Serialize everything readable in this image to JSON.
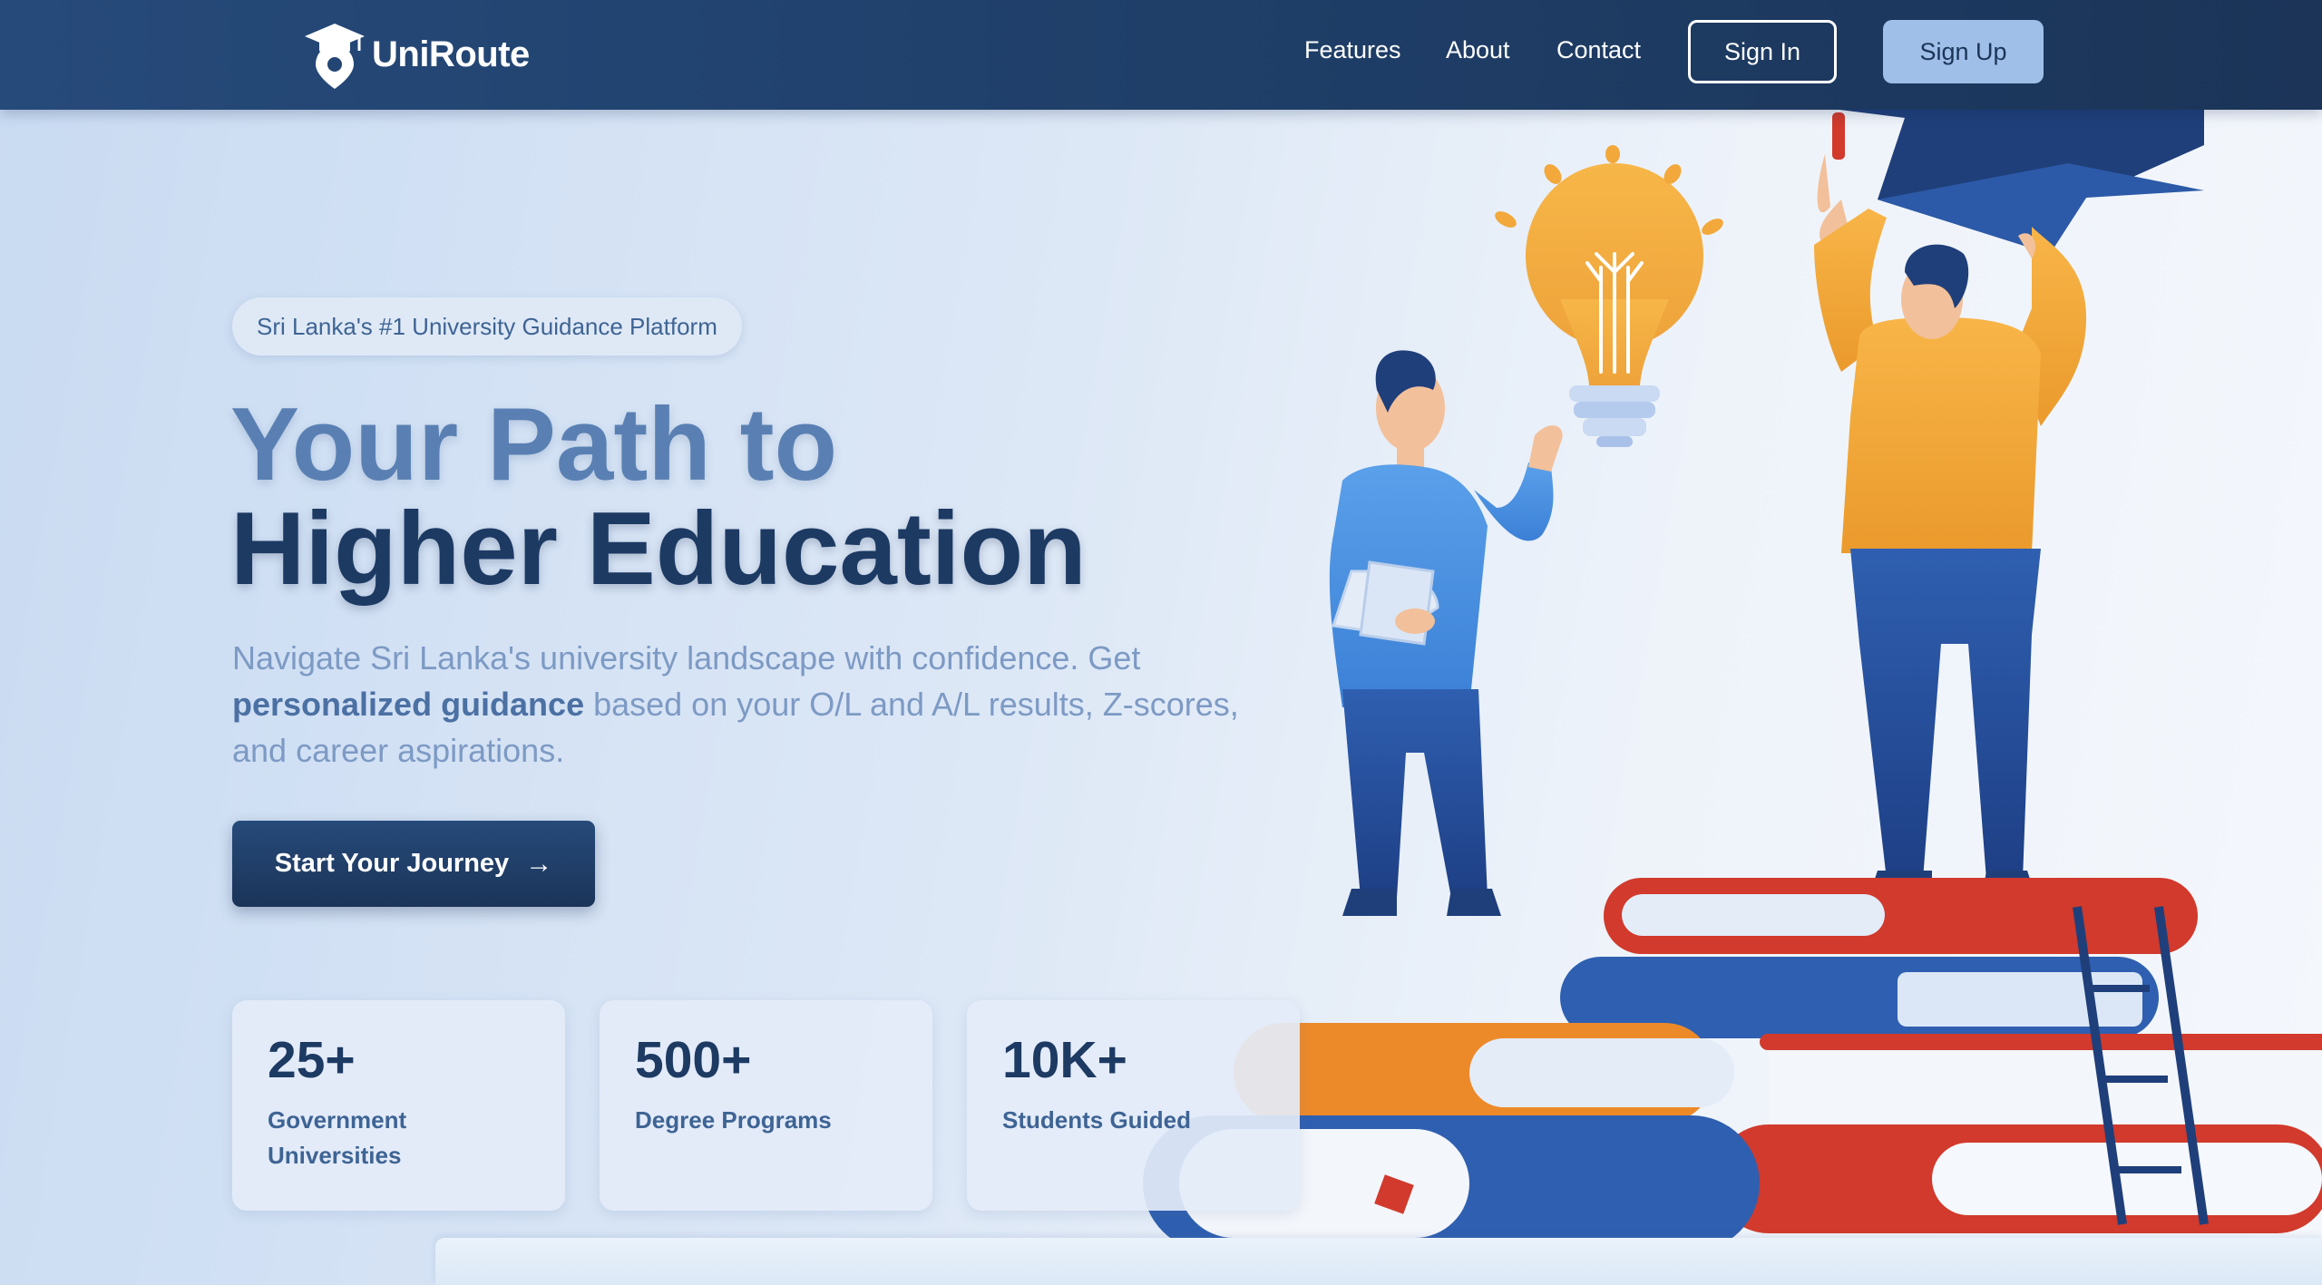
{
  "navbar": {
    "brand": "UniRoute",
    "links": [
      "Features",
      "About",
      "Contact"
    ],
    "sign_in": "Sign In",
    "sign_up": "Sign Up"
  },
  "hero": {
    "badge": "Sri Lanka's #1 University Guidance Platform",
    "title_line1": "Your Path to",
    "title_line2": "Higher Education",
    "lead_before": "Navigate Sri Lanka's university landscape with confidence. Get ",
    "lead_strong": "personalized guidance",
    "lead_after": " based on your O/L and A/L results, Z-scores, and career aspirations.",
    "cta": "Start Your Journey",
    "cta_icon": "arrow-right-icon"
  },
  "stats": [
    {
      "value": "25+",
      "label": "Government Universities"
    },
    {
      "value": "500+",
      "label": "Degree Programs"
    },
    {
      "value": "10K+",
      "label": "Students Guided"
    }
  ],
  "colors": {
    "navbar": "#1f3f69",
    "primary_dark": "#1d3a63",
    "accent_light": "#9fbfe8",
    "title_light": "#5a80b3"
  }
}
